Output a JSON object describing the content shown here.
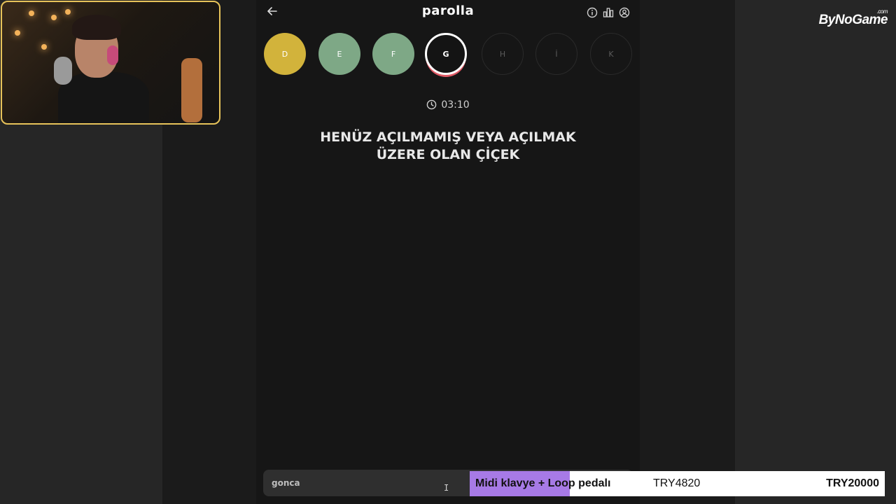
{
  "stream": {
    "brand": "ByNoGame",
    "brand_suffix": ".com"
  },
  "header": {
    "title": "parolla",
    "icons": [
      "back-arrow-icon",
      "info-icon",
      "stats-icon",
      "user-icon"
    ]
  },
  "letters": [
    {
      "letter": "D",
      "state": "wrong"
    },
    {
      "letter": "E",
      "state": "correct"
    },
    {
      "letter": "F",
      "state": "correct"
    },
    {
      "letter": "G",
      "state": "current"
    },
    {
      "letter": "H",
      "state": "pending"
    },
    {
      "letter": "İ",
      "state": "pending"
    },
    {
      "letter": "K",
      "state": "pending"
    }
  ],
  "timer": {
    "value": "03:10"
  },
  "question": {
    "line1": "HENÜZ AÇILMAMIŞ VEYA AÇILMAK",
    "line2": "ÜZERE OLAN ÇİÇEK"
  },
  "answer": {
    "value": "gonca"
  },
  "goal": {
    "label": "Midi klavye + Loop pedalı",
    "current": "TRY4820",
    "target": "TRY20000",
    "progress": 0.241
  },
  "colors": {
    "wrong": "#d2b33b",
    "correct": "#7ea886",
    "current_ring": "#ffffff",
    "current_underline": "#e05a66",
    "goal_fill": "#a77ae6",
    "webcam_border": "#e7c35a"
  }
}
